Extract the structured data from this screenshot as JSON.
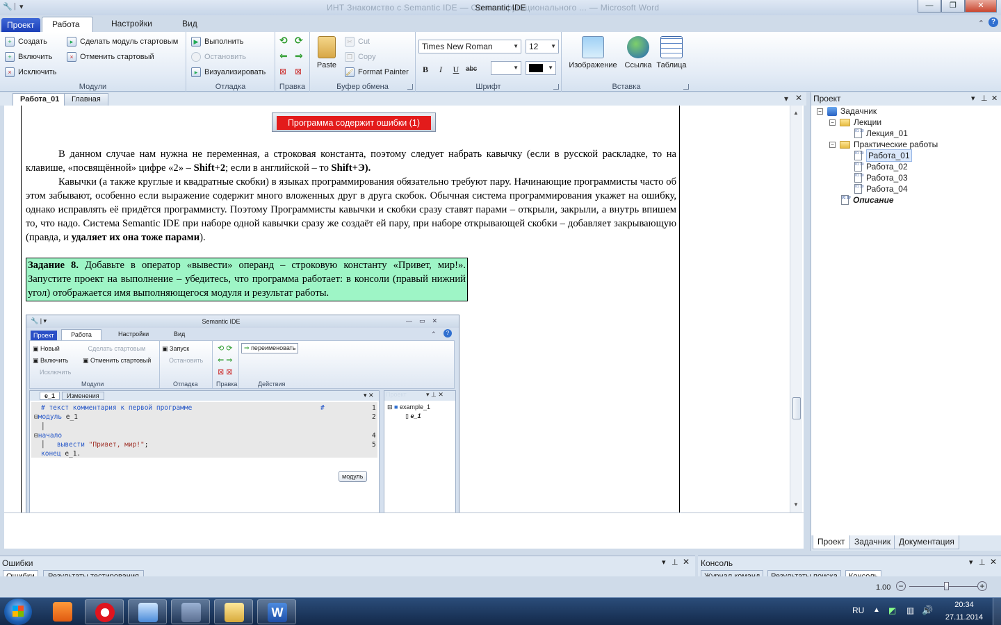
{
  "window": {
    "title": "Semantic IDE",
    "ghost_title": "ИНТ Знакомство с Semantic IDE — Основы функционального ... — Microsoft Word",
    "min": "—",
    "max": "❐",
    "close": "✕"
  },
  "tabs": {
    "project": "Проект",
    "work": "Работа",
    "settings": "Настройки",
    "view": "Вид"
  },
  "ribbon": {
    "modules": {
      "label": "Модули",
      "create": "Создать",
      "include": "Включить",
      "exclude": "Исключить",
      "make_start": "Сделать модуль стартовым",
      "cancel_start": "Отменить стартовый"
    },
    "debug": {
      "label": "Отладка",
      "run": "Выполнить",
      "stop": "Остановить",
      "visualize": "Визуализировать"
    },
    "edit": {
      "label": "Правка"
    },
    "clipboard": {
      "label": "Буфер обмена",
      "paste": "Paste",
      "cut": "Cut",
      "copy": "Copy",
      "format_painter": "Format Painter"
    },
    "font": {
      "label": "Шрифт",
      "family": "Times New Roman",
      "size": "12",
      "bold": "B",
      "italic": "I",
      "underline": "U",
      "strike": "abc"
    },
    "insert": {
      "label": "Вставка",
      "image": "Изображение",
      "link": "Ссылка",
      "table": "Таблица"
    }
  },
  "doc_tabs": {
    "t1": "Работа_01",
    "t2": "Главная"
  },
  "document": {
    "error_banner": "Программа содержит ошибки (1)",
    "p1a": "В данном случае нам нужна не переменная, а строковая константа, поэтому следует набрать кавычку (если в русской раскладке, то на клавише, «посвящённой» цифре «2» – ",
    "p1b": "Shift",
    "p1c": "+",
    "p1d": "2",
    "p1e": "; если в английской – то ",
    "p1f": "Shift",
    "p1g": "+Э).",
    "p2a": "Кавычки (а также круглые и квадратные скобки) в языках программирования обязательно требуют пару. Начинающие программисты часто об этом забывают, особенно если выражение содержит много вложенных друг в друга скобок. Обычная система программирования укажет на ошибку, однако исправлять её придётся программисту. Поэтому Программисты кавычки и скобки сразу ставят парами – открыли, закрыли, а внутрь впишем то, что надо. Система Semantic IDE при наборе одной кавычки сразу же создаёт ей пару, при наборе открывающей скобки – добавляет закрывающую (правда, и ",
    "p2b": "удаляет их она тоже парами",
    "p2c": ").",
    "task_title": "Задание 8.",
    "task_text": " Добавьте в оператор «вывести» операнд – строковую константу «Привет, мир!». Запустите проект на выполнение – убедитесь, что программа работает: в консоли (правый нижний угол) отображается имя выполняющегося модуля и результат работы."
  },
  "inner": {
    "title": "Semantic IDE",
    "tabs": {
      "project": "Проект",
      "work": "Работа",
      "settings": "Настройки",
      "view": "Вид"
    },
    "modules": {
      "new": "Новый",
      "include": "Включить",
      "exclude": "Исключить",
      "make_start": "Сделать стартовым",
      "cancel_start": "Отменить стартовый",
      "label": "Модули"
    },
    "debug": {
      "run": "Запуск",
      "stop": "Остановить",
      "label": "Отладка"
    },
    "edit_label": "Правка",
    "actions": {
      "rename": "переименовать",
      "label": "Действия"
    },
    "doc_tabs": {
      "t1": "e_1",
      "t2": "Изменения"
    },
    "code": {
      "l1": "# текст комментария к первой программе",
      "l1hash": "#",
      "l2kw": "модуль",
      "l2": " e_1",
      "l4": "начало",
      "l5kw": "вывести",
      "l5str": " \"Привет, мир!\"",
      "l5end": ";",
      "l6kw": "конец",
      "l6": " e_1.",
      "n1": "1",
      "n2": "2",
      "n4": "4",
      "n5": "5"
    },
    "module_btn": "модуль",
    "project_pane": "Проект",
    "tree_root": "example_1",
    "tree_child": "e_1"
  },
  "project": {
    "header": "Проект",
    "root": "Задачник",
    "lectures": "Лекции",
    "lecture1": "Лекция_01",
    "practice": "Практические работы",
    "works": [
      "Работа_01",
      "Работа_02",
      "Работа_03",
      "Работа_04"
    ],
    "description": "Описание",
    "tabs": [
      "Проект",
      "Задачник",
      "Документация"
    ]
  },
  "bottom": {
    "errors_title": "Ошибки",
    "errors_tabs": [
      "Ошибки",
      "Результаты тестирования"
    ],
    "console_title": "Консоль",
    "console_tabs": [
      "Журнал команд",
      "Результаты поиска",
      "Консоль"
    ]
  },
  "status": {
    "zoom": "1.00",
    "zoom_fraction": 0.55
  },
  "taskbar": {
    "lang": "RU",
    "time": "20:34",
    "date": "27.11.2014"
  }
}
